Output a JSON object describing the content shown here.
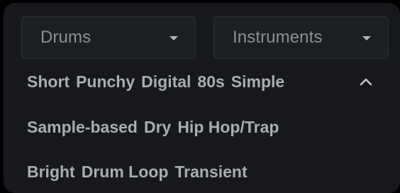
{
  "filters": {
    "category_dropdown": {
      "value": "Drums",
      "icon": "caret-down-icon"
    },
    "instruments_dropdown": {
      "value": "Instruments",
      "icon": "caret-down-icon"
    }
  },
  "tags": {
    "row1": [
      "Short",
      "Punchy",
      "Digital",
      "80s",
      "Simple"
    ],
    "row2": [
      "Sample-based",
      "Dry",
      "Hip Hop/Trap"
    ],
    "row3": [
      "Bright",
      "Drum Loop",
      "Transient"
    ],
    "collapse_icon": "chevron-up-icon"
  },
  "colors": {
    "background": "#17181b",
    "dropdown_bg": "#1c1f21",
    "text": "#aaadb0"
  }
}
